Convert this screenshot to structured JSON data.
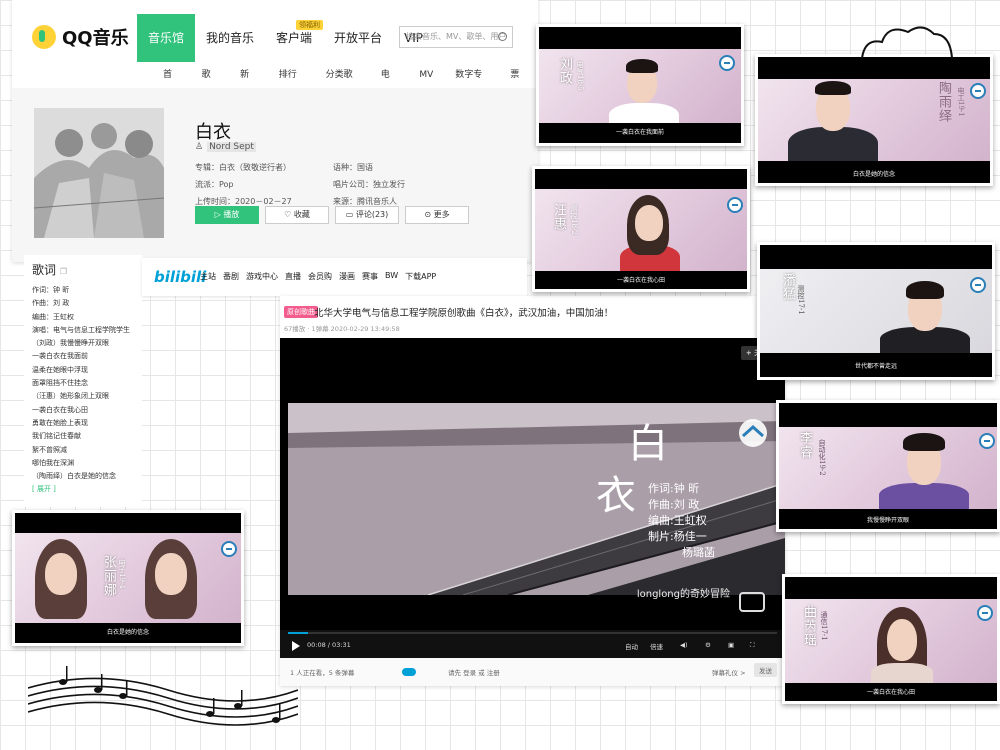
{
  "qq": {
    "logo_text": "QQ音乐",
    "nav": [
      "音乐馆",
      "我的音乐",
      "客户端",
      "开放平台",
      "VIP"
    ],
    "nav_badge": "领福利",
    "search_placeholder": "搜索音乐、MV、歌单、用户",
    "subnav": [
      "首页",
      "歌手",
      "新碟",
      "排行榜",
      "分类歌单",
      "电台",
      "MV",
      "数字专辑",
      "票务"
    ],
    "song": {
      "title": "白衣",
      "artist": "Nord Sept",
      "album_label": "专辑：",
      "album": "白衣（致敬逆行者）",
      "language_label": "语种：",
      "language": "国语",
      "genre_label": "流派：",
      "genre": "Pop",
      "company_label": "唱片公司：",
      "company": "独立发行",
      "release_label": "上传时间：",
      "release_date": "2020－02－27",
      "source_label": "来源：",
      "source": "腾讯音乐人"
    },
    "actions": {
      "play": "播放",
      "collect": "收藏",
      "comment": "评论(23)",
      "more": "更多"
    }
  },
  "lyrics": {
    "title": "歌词",
    "lines": [
      "作词：钟 昕",
      "作曲：刘 政",
      "编曲：王虹权",
      "演唱：电气与信息工程学院学生",
      "（刘政）我慢慢睁开双眼",
      "一袭白衣在我面前",
      "温柔在她眼中浮现",
      "面罩阻挡不住挂念",
      "（汪惠）她形象闭上双眼",
      "一袭白衣在我心田",
      "勇敢在她脸上表现",
      "我们铭记住春献",
      "絮不曾照减",
      "哪怕我在深渊",
      "（陶雨绎）白衣是她的信念"
    ],
    "more": "[ 展开 ]"
  },
  "bili": {
    "logo": "bilibili",
    "nav": [
      "主站",
      "番剧",
      "游戏中心",
      "直播",
      "会员购",
      "漫画",
      "赛事",
      "BW",
      "下载APP"
    ],
    "video": {
      "tag": "原创歌曲",
      "title": "北华大学电气与信息工程学院原创歌曲《白衣》，武汉加油，中国加油！",
      "meta": "67播放 · 1弹幕    2020-02-29 13:49:58",
      "follow": "+ 关注",
      "big_char_1": "白",
      "big_char_2": "衣",
      "credits": [
        "作词:钟    昕",
        "作曲:刘    政",
        "编曲:王虹权",
        "制片:杨佳一",
        "杨璐菡"
      ],
      "watermark": "longlong的奇妙冒险",
      "time": "00:08 / 03:31",
      "progress": 0.04,
      "ctrl_auto": "自动",
      "ctrl_quality": "倍速",
      "viewers": "1 人正在看，5 条弹幕",
      "login_hint": "请先 登录 或 注册",
      "danmaku_label": "弹幕礼仪 >",
      "send": "发送"
    }
  },
  "cards": [
    {
      "name": "刘政",
      "class": "电气18-5",
      "subtitle": "一袭白衣在我面前"
    },
    {
      "name": "陶雨绎",
      "class": "电工19-1",
      "subtitle": "白衣是她的信念"
    },
    {
      "name": "汪惠",
      "class": "测控18-2",
      "subtitle": "一袭白衣在我心田"
    },
    {
      "name": "潘猛",
      "class": "测控17-1",
      "subtitle": "世代都不曾走远"
    },
    {
      "name": "李睿",
      "class": "自动化19-2",
      "subtitle": "我慢慢睁开双眼"
    },
    {
      "name": "张丽娜",
      "class": "电子19-4",
      "subtitle": "白衣是她的信念"
    },
    {
      "name": "曲芮瑶",
      "class": "通信17-1",
      "subtitle": "一袭白衣在我心田"
    }
  ],
  "colors": {
    "qq_green": "#31c27c",
    "bili_blue": "#00a1d6",
    "bili_pink": "#f25d8e"
  }
}
